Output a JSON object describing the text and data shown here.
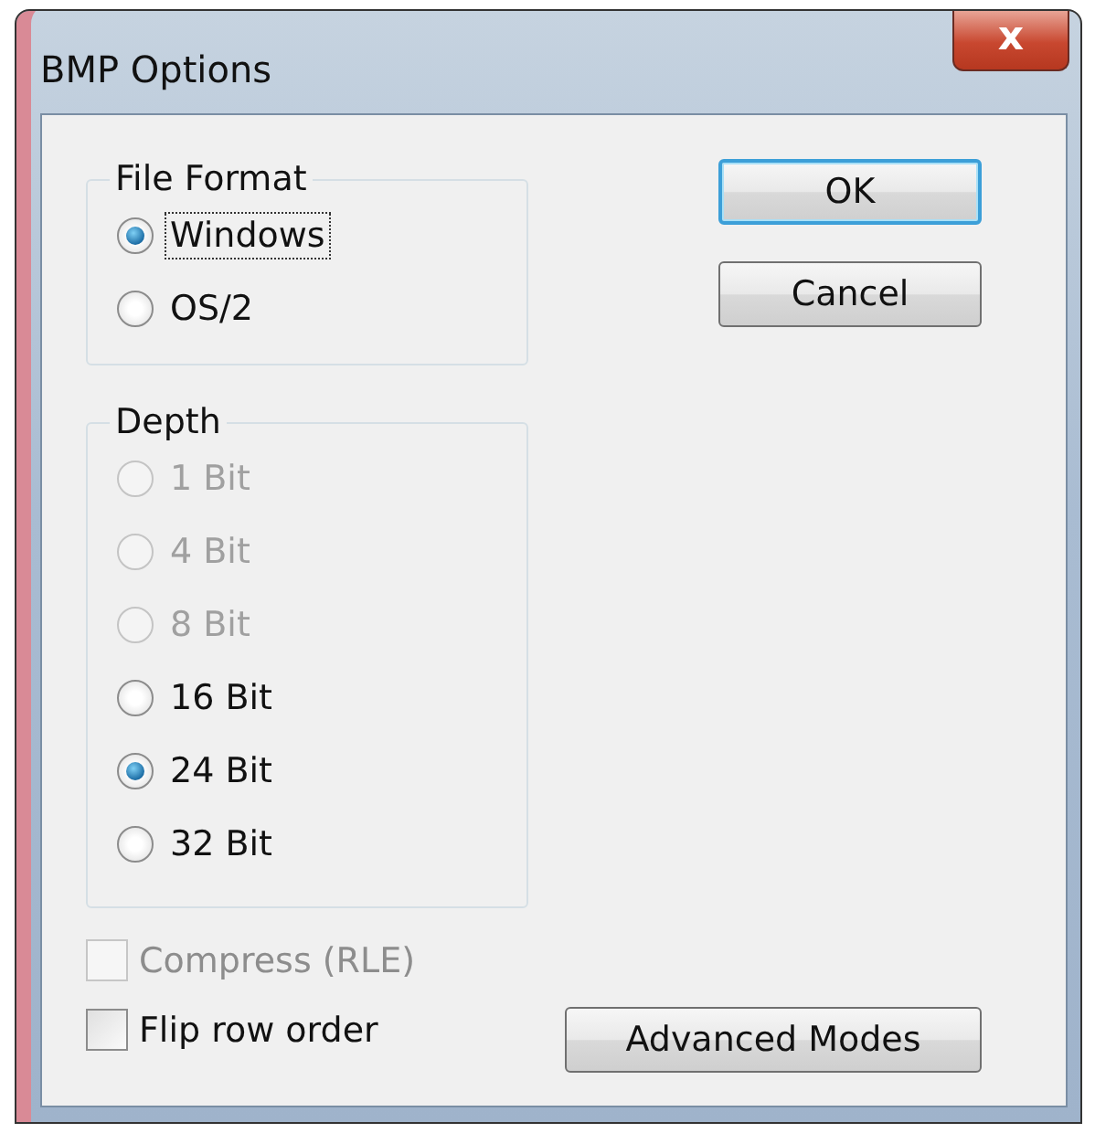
{
  "window": {
    "title": "BMP Options",
    "close": "x"
  },
  "file_format": {
    "label": "File Format",
    "options": [
      {
        "label": "Windows",
        "selected": true,
        "disabled": false,
        "focused": true
      },
      {
        "label": "OS/2",
        "selected": false,
        "disabled": false,
        "focused": false
      }
    ]
  },
  "depth": {
    "label": "Depth",
    "options": [
      {
        "label": "1 Bit",
        "selected": false,
        "disabled": true,
        "focused": false
      },
      {
        "label": "4 Bit",
        "selected": false,
        "disabled": true,
        "focused": false
      },
      {
        "label": "8 Bit",
        "selected": false,
        "disabled": true,
        "focused": false
      },
      {
        "label": "16 Bit",
        "selected": false,
        "disabled": false,
        "focused": false
      },
      {
        "label": "24 Bit",
        "selected": true,
        "disabled": false,
        "focused": false
      },
      {
        "label": "32 Bit",
        "selected": false,
        "disabled": false,
        "focused": false
      }
    ]
  },
  "checkboxes": [
    {
      "label": "Compress (RLE)",
      "checked": false,
      "disabled": true
    },
    {
      "label": "Flip row order",
      "checked": false,
      "disabled": false
    }
  ],
  "buttons": [
    {
      "label": "OK",
      "default": true
    },
    {
      "label": "Cancel",
      "default": false
    }
  ],
  "advanced_button": {
    "label": "Advanced Modes",
    "default": false
  }
}
